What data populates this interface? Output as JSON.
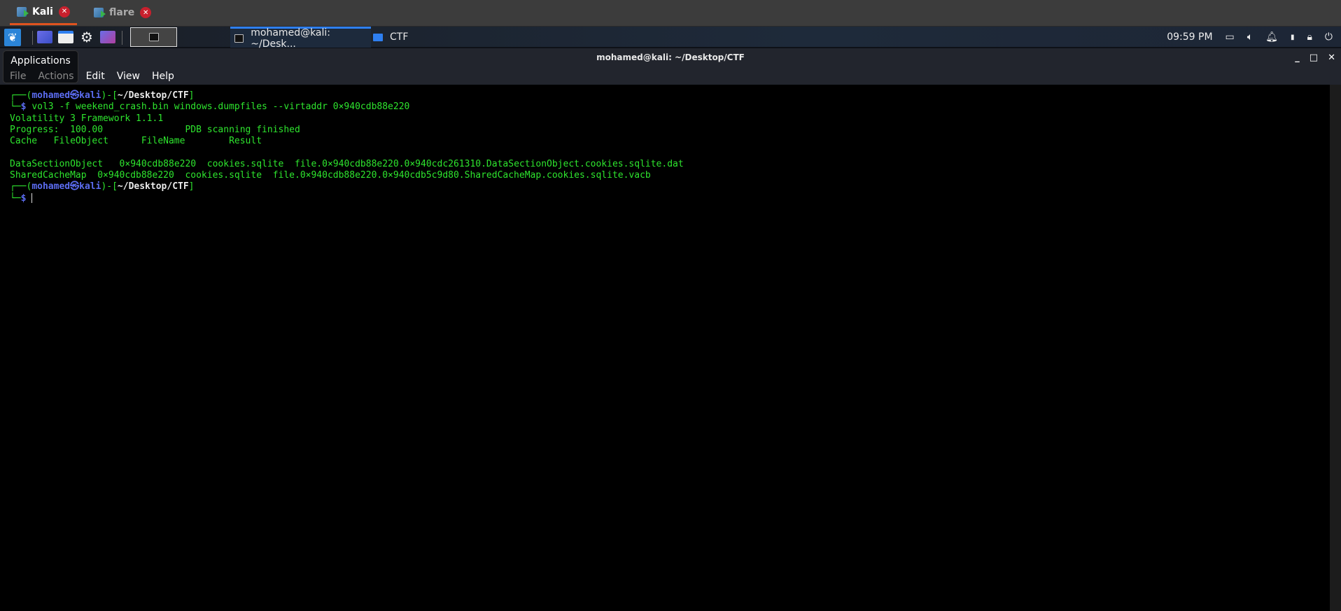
{
  "vm_tabs": [
    {
      "label": "Kali",
      "active": true
    },
    {
      "label": "flare",
      "active": false
    }
  ],
  "taskbar": {
    "active_task": "mohamed@kali: ~/Desk...",
    "second_task": "CTF",
    "clock": "09:59 PM"
  },
  "window": {
    "title": "mohamed@kali: ~/Desktop/CTF",
    "menu": [
      "File",
      "Actions",
      "Edit",
      "View",
      "Help"
    ],
    "applications_tooltip": "Applications"
  },
  "terminal": {
    "user": "mohamed",
    "host": "kali",
    "symbol": "㉿",
    "cwd": "~/Desktop/CTF",
    "command": "vol3 -f weekend_crash.bin windows.dumpfiles --virtaddr 0×940cdb88e220",
    "output": [
      "Volatility 3 Framework 1.1.1",
      "Progress:  100.00\t\tPDB scanning finished",
      "Cache\tFileObject\tFileName\tResult",
      "",
      "DataSectionObject\t0×940cdb88e220\tcookies.sqlite\tfile.0×940cdb88e220.0×940cdc261310.DataSectionObject.cookies.sqlite.dat",
      "SharedCacheMap\t0×940cdb88e220\tcookies.sqlite\tfile.0×940cdb88e220.0×940cdb5c9d80.SharedCacheMap.cookies.sqlite.vacb"
    ]
  },
  "colors": {
    "prompt_blue": "#5b6cf0",
    "terminal_green": "#2ee52e",
    "accent_tab": "#e0531f",
    "kali_blue": "#2b84d8"
  }
}
